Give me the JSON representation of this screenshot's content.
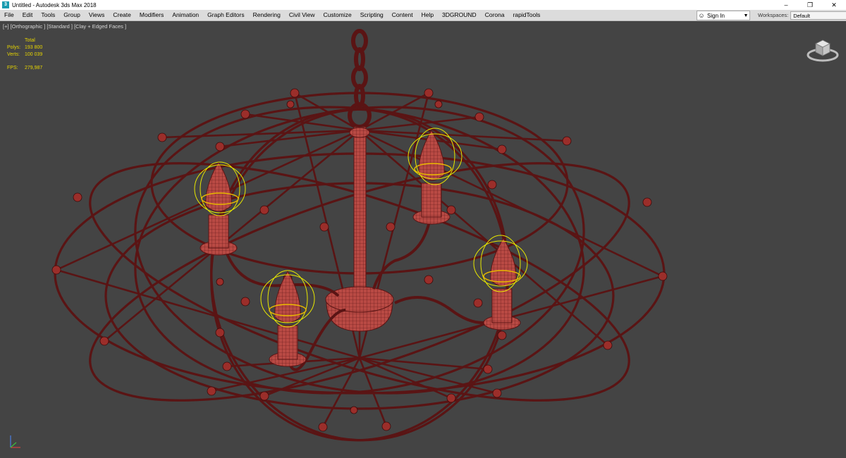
{
  "window": {
    "title": "Untitled - Autodesk 3ds Max 2018",
    "app_icon": "3ds-max-icon",
    "controls": [
      "minimize-icon",
      "restore-icon",
      "close-icon"
    ]
  },
  "menu": {
    "items": [
      "File",
      "Edit",
      "Tools",
      "Group",
      "Views",
      "Create",
      "Modifiers",
      "Animation",
      "Graph Editors",
      "Rendering",
      "Civil View",
      "Customize",
      "Scripting",
      "Content",
      "Help",
      "3DGROUND",
      "Corona",
      "rapidTools"
    ],
    "signin_label": "Sign In",
    "workspaces_label": "Workspaces:",
    "workspaces_value": "Default"
  },
  "viewport": {
    "label": "[+] [Orthographic ] [Standard ] [Clay + Edged Faces ]",
    "stats": {
      "total_label": "Total",
      "polys_label": "Polys:",
      "polys_value": "193 800",
      "verts_label": "Verts:",
      "verts_value": "100 039",
      "fps_label": "FPS:",
      "fps_value": "279,987"
    }
  },
  "colors": {
    "viewport_bg": "#444444",
    "wire": "#5a1414",
    "mesh": "#b94a44",
    "selection": "#e8e800",
    "stats_text": "#e6d400"
  }
}
